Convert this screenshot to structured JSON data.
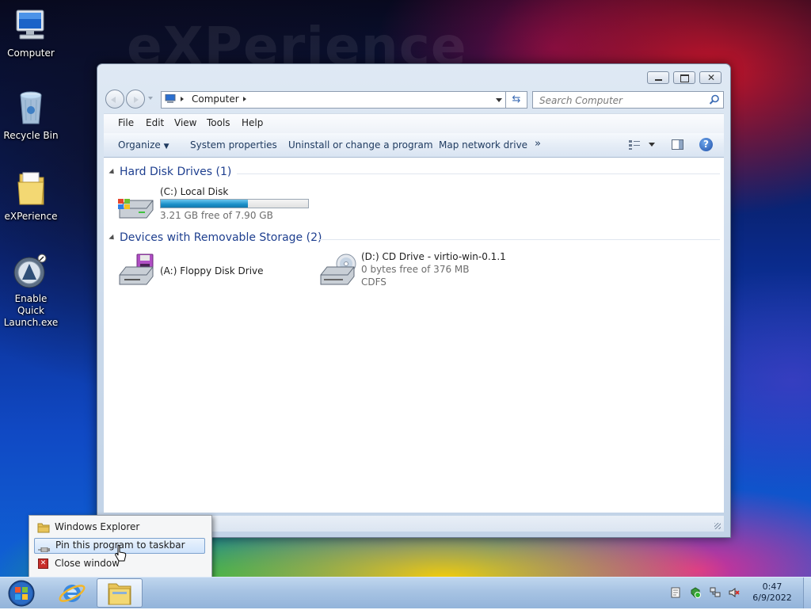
{
  "desktop": {
    "icons": [
      {
        "label": "Computer"
      },
      {
        "label": "Recycle Bin"
      },
      {
        "label": "eXPerience"
      },
      {
        "label": "Enable Quick Launch.exe"
      }
    ],
    "watermark": "eXPerience"
  },
  "window": {
    "address": {
      "root_label": "Computer"
    },
    "search": {
      "placeholder": "Search Computer"
    },
    "menu": [
      "File",
      "Edit",
      "View",
      "Tools",
      "Help"
    ],
    "commands": {
      "organize": "Organize",
      "system_properties": "System properties",
      "uninstall": "Uninstall or change a program",
      "map_drive": "Map network drive",
      "more": "»"
    },
    "groups": {
      "hdd": {
        "title": "Hard Disk Drives (1)",
        "items": [
          {
            "name": "(C:) Local Disk",
            "free": "3.21 GB free of 7.90 GB",
            "usage_fraction": 0.594
          }
        ]
      },
      "removable": {
        "title": "Devices with Removable Storage (2)",
        "items": [
          {
            "name": "(A:) Floppy Disk Drive"
          },
          {
            "name": "(D:) CD Drive - virtio-win-0.1.1",
            "free": "0 bytes free of 376 MB",
            "fs": "CDFS"
          }
        ]
      }
    }
  },
  "jumplist": {
    "items": [
      {
        "label": "Windows Explorer",
        "icon": "folder-icon"
      },
      {
        "label": "Pin this program to taskbar",
        "icon": "pin-icon",
        "highlighted": true
      },
      {
        "label": "Close window",
        "icon": "close-icon"
      }
    ]
  },
  "taskbar": {
    "clock": {
      "time": "0:47",
      "date": "6/9/2022"
    }
  },
  "colors": {
    "accent": "#1e3f8f",
    "drive_bar": "#1a8fc8"
  }
}
